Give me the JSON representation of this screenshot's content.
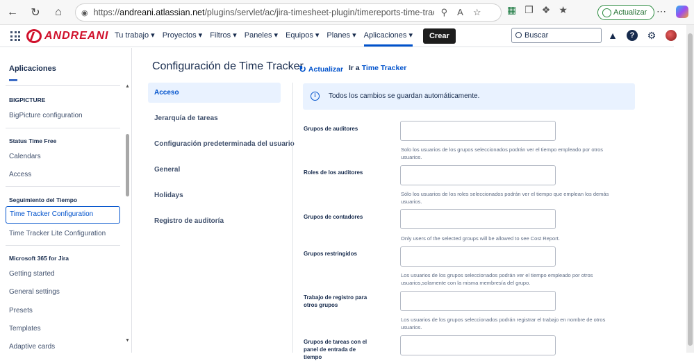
{
  "browser": {
    "url_prefix": "https://",
    "url_host": "andreani.atlassian.net",
    "url_path": "/plugins/servlet/ac/jira-timesheet-plugin/timereports-time-tracking-config?s...",
    "update_label": "Actualizar"
  },
  "header": {
    "logo_text": "ANDREANI",
    "menu": [
      "Tu trabajo",
      "Proyectos",
      "Filtros",
      "Paneles",
      "Equipos",
      "Planes",
      "Aplicaciones"
    ],
    "active_menu": "Aplicaciones",
    "create_label": "Crear",
    "search_placeholder": "Buscar",
    "help_glyph": "?"
  },
  "sidebar": {
    "title": "Aplicaciones",
    "sections": [
      {
        "heading": "BIGPICTURE",
        "items": [
          "BigPicture configuration"
        ]
      },
      {
        "heading": "Status Time Free",
        "items": [
          "Calendars",
          "Access"
        ]
      },
      {
        "heading": "Seguimiento del Tiempo",
        "items": [
          "Time Tracker Configuration",
          "Time Tracker Lite Configuration"
        ]
      },
      {
        "heading": "Microsoft 365 for Jira",
        "items": [
          "Getting started",
          "General settings",
          "Presets",
          "Templates",
          "Adaptive cards"
        ]
      }
    ],
    "selected_item": "Time Tracker Configuration"
  },
  "page": {
    "title": "Configuración de Time Tracker",
    "refresh_label": "Actualizar",
    "goto_prefix": "Ir a",
    "goto_link": "Time Tracker"
  },
  "config_nav": {
    "items": [
      "Acceso",
      "Jerarquía de tareas",
      "Configuración predeterminada del usuario",
      "General",
      "Holidays",
      "Registro de auditoría"
    ],
    "active": "Acceso"
  },
  "info_banner": {
    "icon": "info-icon",
    "text": "Todos los cambios se guardan automáticamente."
  },
  "fields": [
    {
      "label": "Grupos de auditores",
      "value": "",
      "help": "Solo los usuarios de los grupos seleccionados podrán ver el tiempo empleado por otros usuarios."
    },
    {
      "label": "Roles de los auditores",
      "value": "",
      "help": "Sólo los usuarios de los roles seleccionados podrán ver el tiempo que emplean los demás usuarios."
    },
    {
      "label": "Grupos de contadores",
      "value": "",
      "help": "Only users of the selected groups will be allowed to see Cost Report."
    },
    {
      "label": "Grupos restringidos",
      "value": "",
      "help": "Los usuarios de los grupos seleccionados podrán ver el tiempo empleado por otros usuarios,solamente con la misma membresía del grupo."
    },
    {
      "label": "Trabajo de registro para otros grupos",
      "value": "",
      "help": "Los usuarios de los grupos seleccionados podrán registrar el trabajo en nombre de otros usuarios."
    },
    {
      "label": "Grupos de tareas con el panel de entrada de tiempo",
      "value": "",
      "help": ""
    }
  ]
}
